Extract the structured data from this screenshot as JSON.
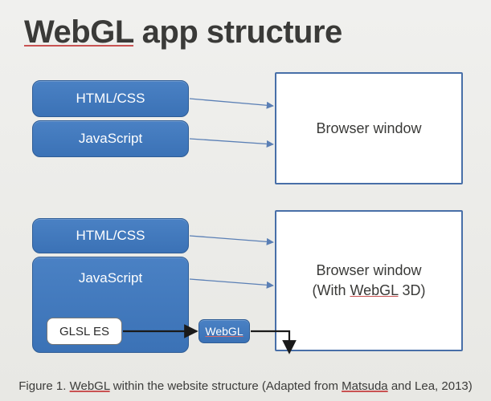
{
  "title": {
    "prefix": "WebGL",
    "rest": " app structure"
  },
  "top": {
    "html_css": "HTML/CSS",
    "javascript": "JavaScript",
    "window": "Browser window"
  },
  "bottom": {
    "html_css": "HTML/CSS",
    "javascript": "JavaScript",
    "glsl": "GLSL ES",
    "webgl": "WebGL",
    "window_line1": "Browser window",
    "window_line2": "(With ",
    "window_webgl": "WebGL",
    "window_line2_end": " 3D)"
  },
  "caption": {
    "prefix": "Figure 1. ",
    "webgl": "WebGL",
    "mid": " within the website structure (Adapted from ",
    "matsuda": "Matsuda",
    "end": " and Lea, 2013)"
  }
}
